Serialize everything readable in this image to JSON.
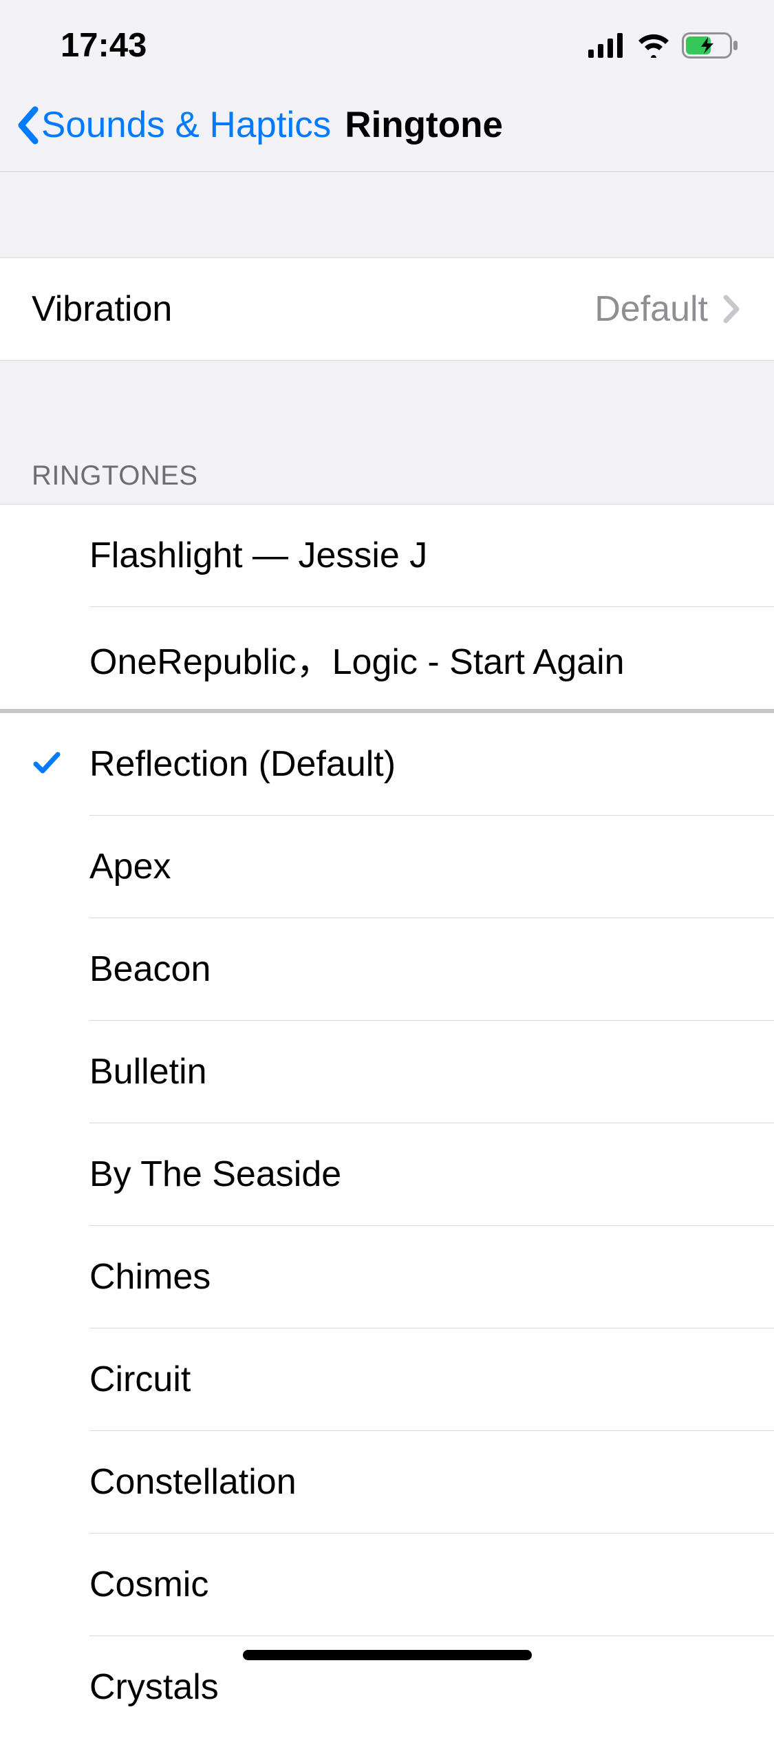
{
  "status": {
    "time": "17:43"
  },
  "nav": {
    "back_label": "Sounds & Haptics",
    "title": "Ringtone"
  },
  "vibration": {
    "label": "Vibration",
    "value": "Default"
  },
  "ringtones_header": "RINGTONES",
  "custom": [
    {
      "label": "Flashlight — Jessie J",
      "selected": false
    },
    {
      "label": "OneRepublic，Logic - Start Again",
      "selected": false
    }
  ],
  "builtin": [
    {
      "label": "Reflection (Default)",
      "selected": true
    },
    {
      "label": "Apex",
      "selected": false
    },
    {
      "label": "Beacon",
      "selected": false
    },
    {
      "label": "Bulletin",
      "selected": false
    },
    {
      "label": "By The Seaside",
      "selected": false
    },
    {
      "label": "Chimes",
      "selected": false
    },
    {
      "label": "Circuit",
      "selected": false
    },
    {
      "label": "Constellation",
      "selected": false
    },
    {
      "label": "Cosmic",
      "selected": false
    },
    {
      "label": "Crystals",
      "selected": false
    }
  ]
}
